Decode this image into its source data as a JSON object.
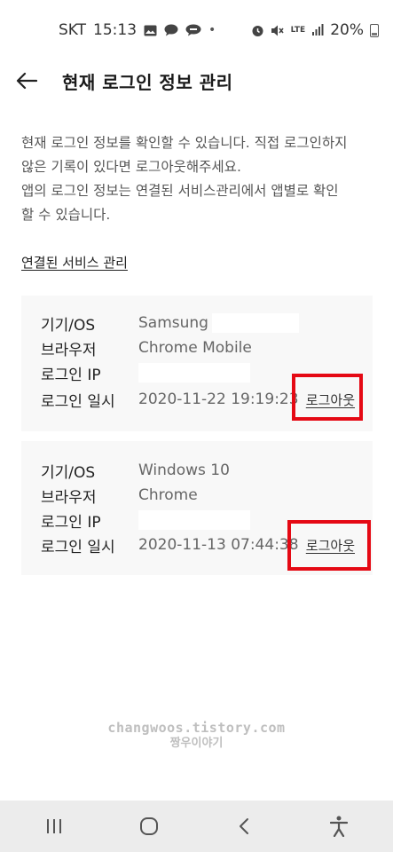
{
  "status_bar": {
    "carrier": "SKT",
    "time": "15:13",
    "network": "LTE",
    "battery": "20%",
    "icons": [
      "gallery-icon",
      "chat-icon",
      "talk-icon",
      "alarm-icon",
      "mute-icon",
      "lte-icon",
      "signal-icon",
      "battery-icon"
    ]
  },
  "header": {
    "title": "현재 로그인 정보 관리",
    "back_icon": "arrow-left-icon"
  },
  "description": {
    "line1": "현재 로그인 정보를 확인할 수 있습니다. 직접 로그인하지",
    "line2": "않은 기록이 있다면 로그아웃해주세요.",
    "line3": "앱의 로그인 정보는 연결된 서비스관리에서 앱별로 확인",
    "line4": "할 수 있습니다."
  },
  "service_link": "연결된 서비스 관리",
  "labels": {
    "device": "기기/OS",
    "browser": "브라우저",
    "ip": "로그인 IP",
    "datetime": "로그인 일시"
  },
  "sessions": [
    {
      "device": "Samsung",
      "browser": "Chrome Mobile",
      "ip": "",
      "datetime": "2020-11-22 19:19:23",
      "logout": "로그아웃"
    },
    {
      "device": "Windows 10",
      "browser": "Chrome",
      "ip": "",
      "datetime": "2020-11-13 07:44:38",
      "logout": "로그아웃"
    }
  ],
  "watermark": {
    "line1": "changwoos.tistory.com",
    "line2": "짱우이야기"
  },
  "nav_bar": {
    "icons": [
      "recent-apps-icon",
      "home-icon",
      "back-icon",
      "accessibility-icon"
    ]
  },
  "colors": {
    "highlight": "#e50914",
    "card_background": "#f8f8f8",
    "nav_background": "#ececec"
  }
}
